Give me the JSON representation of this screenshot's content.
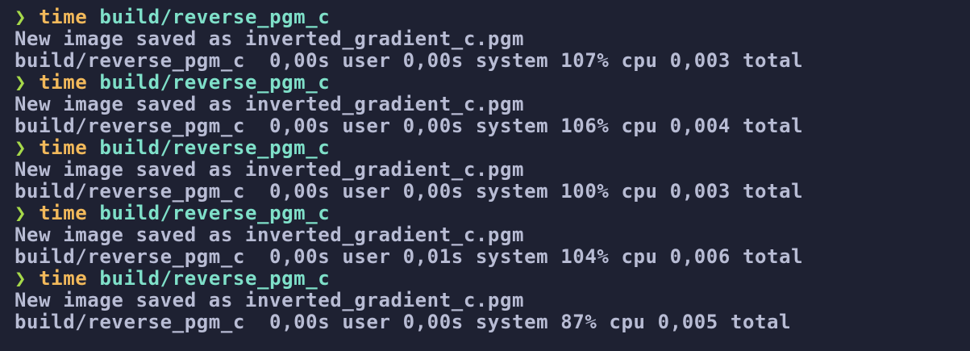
{
  "terminal": {
    "blocks": [
      {
        "prompt": "❯",
        "command": "time",
        "argument": "build/reverse_pgm_c",
        "message": "New image saved as inverted_gradient_c.pgm",
        "timing": "build/reverse_pgm_c  0,00s user 0,00s system 107% cpu 0,003 total"
      },
      {
        "prompt": "❯",
        "command": "time",
        "argument": "build/reverse_pgm_c",
        "message": "New image saved as inverted_gradient_c.pgm",
        "timing": "build/reverse_pgm_c  0,00s user 0,00s system 106% cpu 0,004 total"
      },
      {
        "prompt": "❯",
        "command": "time",
        "argument": "build/reverse_pgm_c",
        "message": "New image saved as inverted_gradient_c.pgm",
        "timing": "build/reverse_pgm_c  0,00s user 0,00s system 100% cpu 0,003 total"
      },
      {
        "prompt": "❯",
        "command": "time",
        "argument": "build/reverse_pgm_c",
        "message": "New image saved as inverted_gradient_c.pgm",
        "timing": "build/reverse_pgm_c  0,00s user 0,01s system 104% cpu 0,006 total"
      },
      {
        "prompt": "❯",
        "command": "time",
        "argument": "build/reverse_pgm_c",
        "message": "New image saved as inverted_gradient_c.pgm",
        "timing": "build/reverse_pgm_c  0,00s user 0,00s system 87% cpu 0,005 total"
      }
    ]
  },
  "colors": {
    "background": "#1e2132",
    "prompt": "#a6d94a",
    "command": "#f2b95b",
    "argument": "#7fe0c9",
    "output": "#b8bcd4"
  }
}
